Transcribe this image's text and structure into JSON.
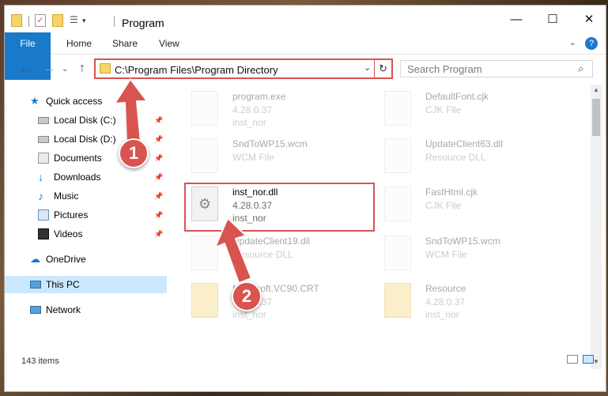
{
  "window": {
    "title": "Program"
  },
  "ribbon": {
    "tabs": [
      "File",
      "Home",
      "Share",
      "View"
    ]
  },
  "address": {
    "path": "C:\\Program Files\\Program Directory"
  },
  "search": {
    "placeholder": "Search Program"
  },
  "nav": {
    "items": [
      {
        "label": "Quick access"
      },
      {
        "label": "Local Disk (C:)"
      },
      {
        "label": "Local Disk (D:)"
      },
      {
        "label": "Documents"
      },
      {
        "label": "Downloads"
      },
      {
        "label": "Music"
      },
      {
        "label": "Pictures"
      },
      {
        "label": "Videos"
      },
      {
        "label": "OneDrive"
      },
      {
        "label": "This PC"
      },
      {
        "label": "Network"
      }
    ]
  },
  "files": [
    {
      "name": "program.exe",
      "line2": "4.28.0.37",
      "line3": "inst_nor"
    },
    {
      "name": "DefaultFont.cjk",
      "line2": "CJK File",
      "line3": ""
    },
    {
      "name": "SndToWP15.wcm",
      "line2": "WCM File",
      "line3": ""
    },
    {
      "name": "UpdateClient63.dll",
      "line2": "Resource DLL",
      "line3": ""
    },
    {
      "name": "inst_nor.dll",
      "line2": "4.28.0.37",
      "line3": "inst_nor"
    },
    {
      "name": "FastHtml.cjk",
      "line2": "CJK File",
      "line3": ""
    },
    {
      "name": "UpdateClient19.dll",
      "line2": "Resource DLL",
      "line3": ""
    },
    {
      "name": "SndToWP15.wcm",
      "line2": "WCM File",
      "line3": ""
    },
    {
      "name": "Microsoft.VC90.CRT",
      "line2": "4.28.0.37",
      "line3": "inst_nor"
    },
    {
      "name": "Resource",
      "line2": "4.28.0.37",
      "line3": "inst_nor"
    }
  ],
  "status": {
    "count": "143 items"
  },
  "callouts": {
    "one": "1",
    "two": "2"
  },
  "colors": {
    "accent": "#1979ca",
    "highlight": "#d9534f",
    "selection": "#cce8ff"
  }
}
